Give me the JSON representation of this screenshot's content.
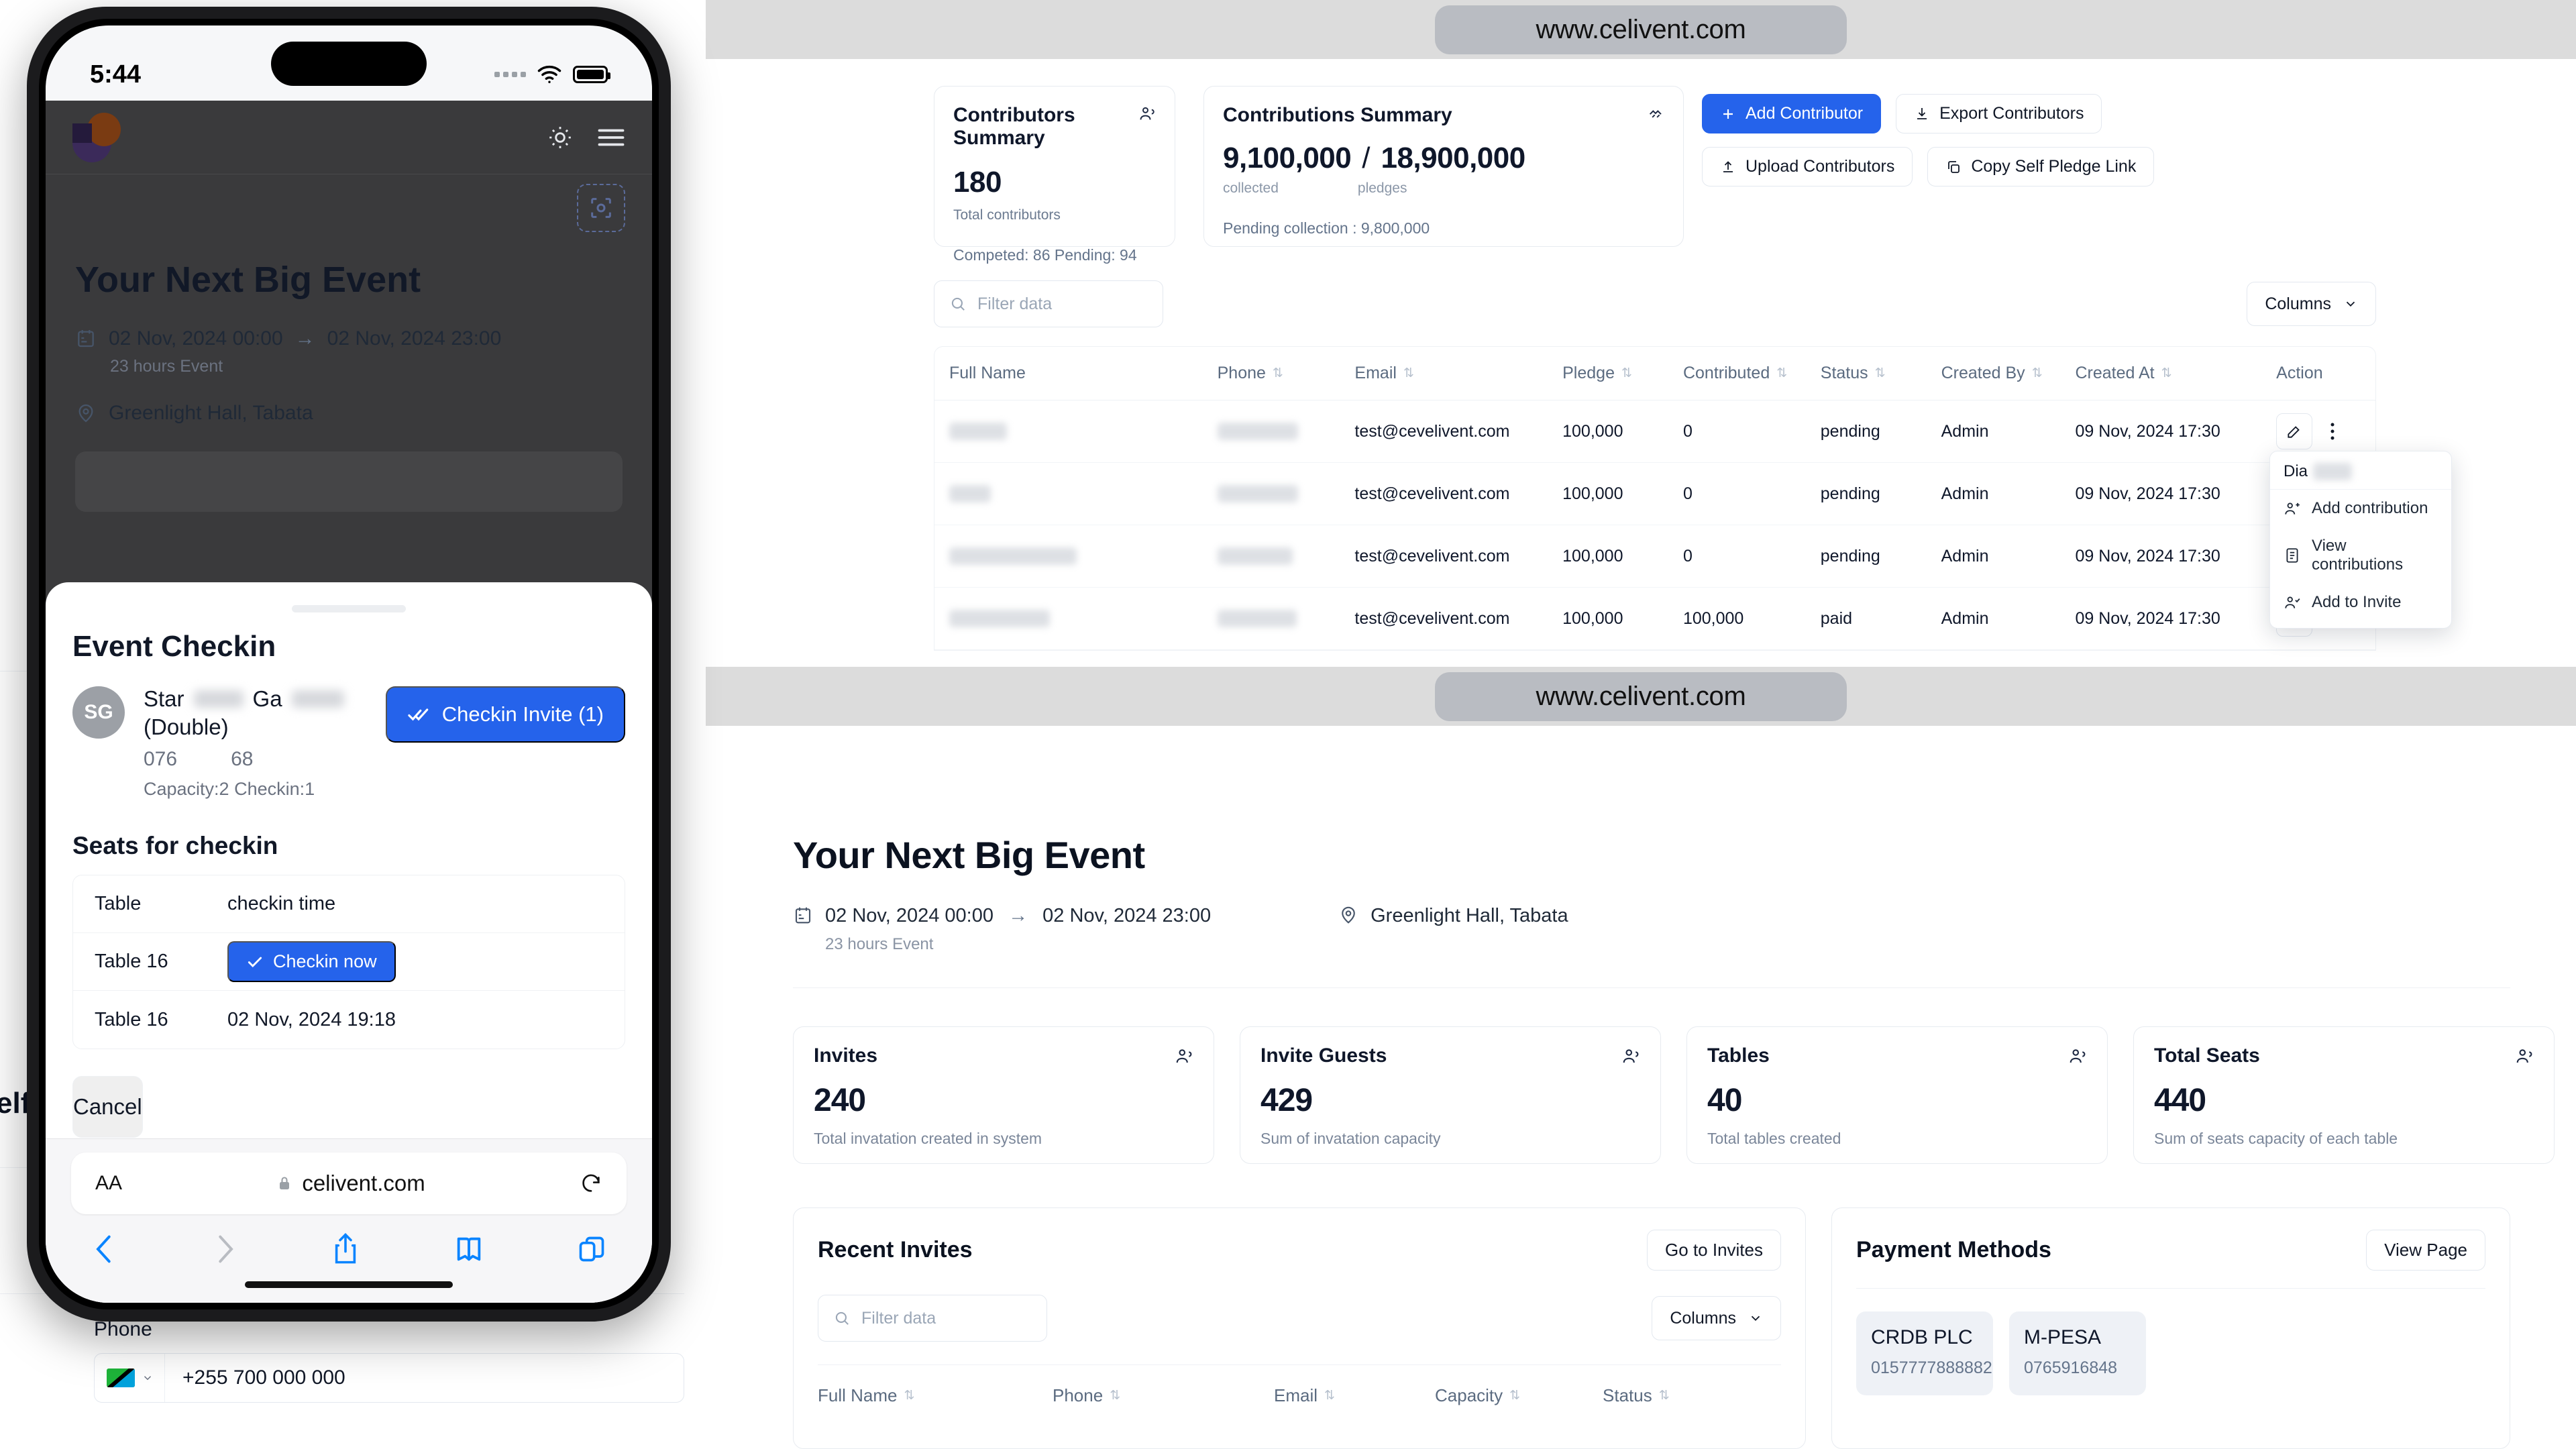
{
  "browser_banner": {
    "url": "www.celivent.com"
  },
  "contributors_panel": {
    "cards": [
      {
        "title": "Contributors Summary",
        "icon": "users-icon",
        "value": "180",
        "subtitle": "Total contributors",
        "footer": "Competed:  86    Pending:  94",
        "competed_label": "Competed:",
        "competed_value": "86",
        "pending_label": "Pending:",
        "pending_value": "94"
      },
      {
        "title": "Contributions Summary",
        "icon": "handshake-icon",
        "collected": "9,100,000",
        "separator": "/",
        "pledges": "18,900,000",
        "collected_label": "collected",
        "pledges_label": "pledges",
        "footer": "Pending collection : 9,800,000"
      }
    ],
    "actions": [
      {
        "label": "Add Contributor",
        "icon": "plus-icon",
        "primary": true
      },
      {
        "label": "Export Contributors",
        "icon": "download-icon",
        "primary": false
      },
      {
        "label": "Upload Contributors",
        "icon": "upload-icon",
        "primary": false
      },
      {
        "label": "Copy Self Pledge Link",
        "icon": "copy-icon",
        "primary": false
      }
    ],
    "filter_placeholder": "Filter data",
    "columns_button": "Columns",
    "table": {
      "headers": [
        "Full Name",
        "Phone",
        "Email",
        "Pledge",
        "Contributed",
        "Status",
        "Created By",
        "Created At",
        "Action"
      ],
      "rows": [
        {
          "full_name": "",
          "phone": "",
          "email": "test@cevelivent.com",
          "pledge": "100,000",
          "contributed": "0",
          "status": "pending",
          "created_by": "Admin",
          "created_at": "09 Nov, 2024 17:30"
        },
        {
          "full_name": "",
          "phone": "",
          "email": "test@cevelivent.com",
          "pledge": "100,000",
          "contributed": "0",
          "status": "pending",
          "created_by": "Admin",
          "created_at": "09 Nov, 2024 17:30"
        },
        {
          "full_name": "",
          "phone": "",
          "email": "test@cevelivent.com",
          "pledge": "100,000",
          "contributed": "0",
          "status": "pending",
          "created_by": "Admin",
          "created_at": "09 Nov, 2024 17:30"
        },
        {
          "full_name": "",
          "phone": "",
          "email": "test@cevelivent.com",
          "pledge": "100,000",
          "contributed": "100,000",
          "status": "paid",
          "created_by": "Admin",
          "created_at": "09 Nov, 2024 17:30"
        }
      ]
    },
    "row_menu": {
      "header": "Dia",
      "items": [
        {
          "label": "Add contribution",
          "icon": "user-plus-icon"
        },
        {
          "label": "View contributions",
          "icon": "list-icon"
        },
        {
          "label": "Add to Invite",
          "icon": "user-check-icon"
        }
      ]
    }
  },
  "event_panel": {
    "title": "Your Next Big Event",
    "date_start": "02 Nov, 2024 00:00",
    "date_arrow": "→",
    "date_end": "02 Nov, 2024 23:00",
    "duration": "23 hours Event",
    "location": "Greenlight Hall, Tabata",
    "stats": [
      {
        "title": "Invites",
        "value": "240",
        "desc": "Total invatation created in system",
        "icon": "users-icon"
      },
      {
        "title": "Invite Guests",
        "value": "429",
        "desc": "Sum of invatation capacity",
        "icon": "users-icon"
      },
      {
        "title": "Tables",
        "value": "40",
        "desc": "Total tables created",
        "icon": "users-icon"
      },
      {
        "title": "Total Seats",
        "value": "440",
        "desc": "Sum of seats capacity of each table",
        "icon": "users-icon"
      }
    ],
    "recent_invites": {
      "title": "Recent Invites",
      "action": "Go to Invites",
      "filter_placeholder": "Filter data",
      "columns_button": "Columns",
      "headers": [
        "Full Name",
        "Phone",
        "Email",
        "Capacity",
        "Status"
      ]
    },
    "payment_methods": {
      "title": "Payment Methods",
      "action": "View Page",
      "methods": [
        {
          "name": "CRDB PLC",
          "account": "0157777888882"
        },
        {
          "name": "M-PESA",
          "account": "0765916848"
        }
      ]
    }
  },
  "background_form": {
    "sliver_text": "elf",
    "phone_label": "Phone",
    "phone_value": "+255 700 000 000"
  },
  "phone": {
    "status_bar": {
      "time": "5:44"
    },
    "app": {
      "event_title": "Your Next Big Event",
      "date_start": "02 Nov, 2024 00:00",
      "date_arrow": "→",
      "date_end": "02 Nov, 2024 23:00",
      "duration": "23 hours Event",
      "location": "Greenlight Hall, Tabata"
    },
    "sheet": {
      "title": "Event Checkin",
      "avatar_initials": "SG",
      "guest_name_part1": "Star",
      "guest_name_part2": "Ga",
      "guest_type": "(Double)",
      "guest_phone_part1": "076",
      "guest_phone_part2": "68",
      "capacity_line": "Capacity:2   Checkin:1",
      "checkin_invite_button": "Checkin Invite (1)",
      "seats_heading": "Seats for checkin",
      "seat_headers": [
        "Table",
        "checkin time"
      ],
      "seat_rows": [
        {
          "table": "Table 16",
          "checkin_time": "",
          "button": "Checkin now"
        },
        {
          "table": "Table 16",
          "checkin_time": "02 Nov, 2024 19:18",
          "button": ""
        }
      ],
      "cancel_button": "Cancel"
    },
    "safari": {
      "text_size_label": "AA",
      "url": "celivent.com",
      "reload_icon": "reload-icon",
      "back_icon": "chevron-left-icon",
      "forward_icon": "chevron-right-icon",
      "share_icon": "share-icon",
      "bookmarks_icon": "book-icon",
      "tabs_icon": "tabs-icon"
    }
  },
  "colors": {
    "accent": "#2563eb",
    "text": "#0f172a",
    "muted": "#6b7280",
    "border": "#e7ebf0"
  }
}
